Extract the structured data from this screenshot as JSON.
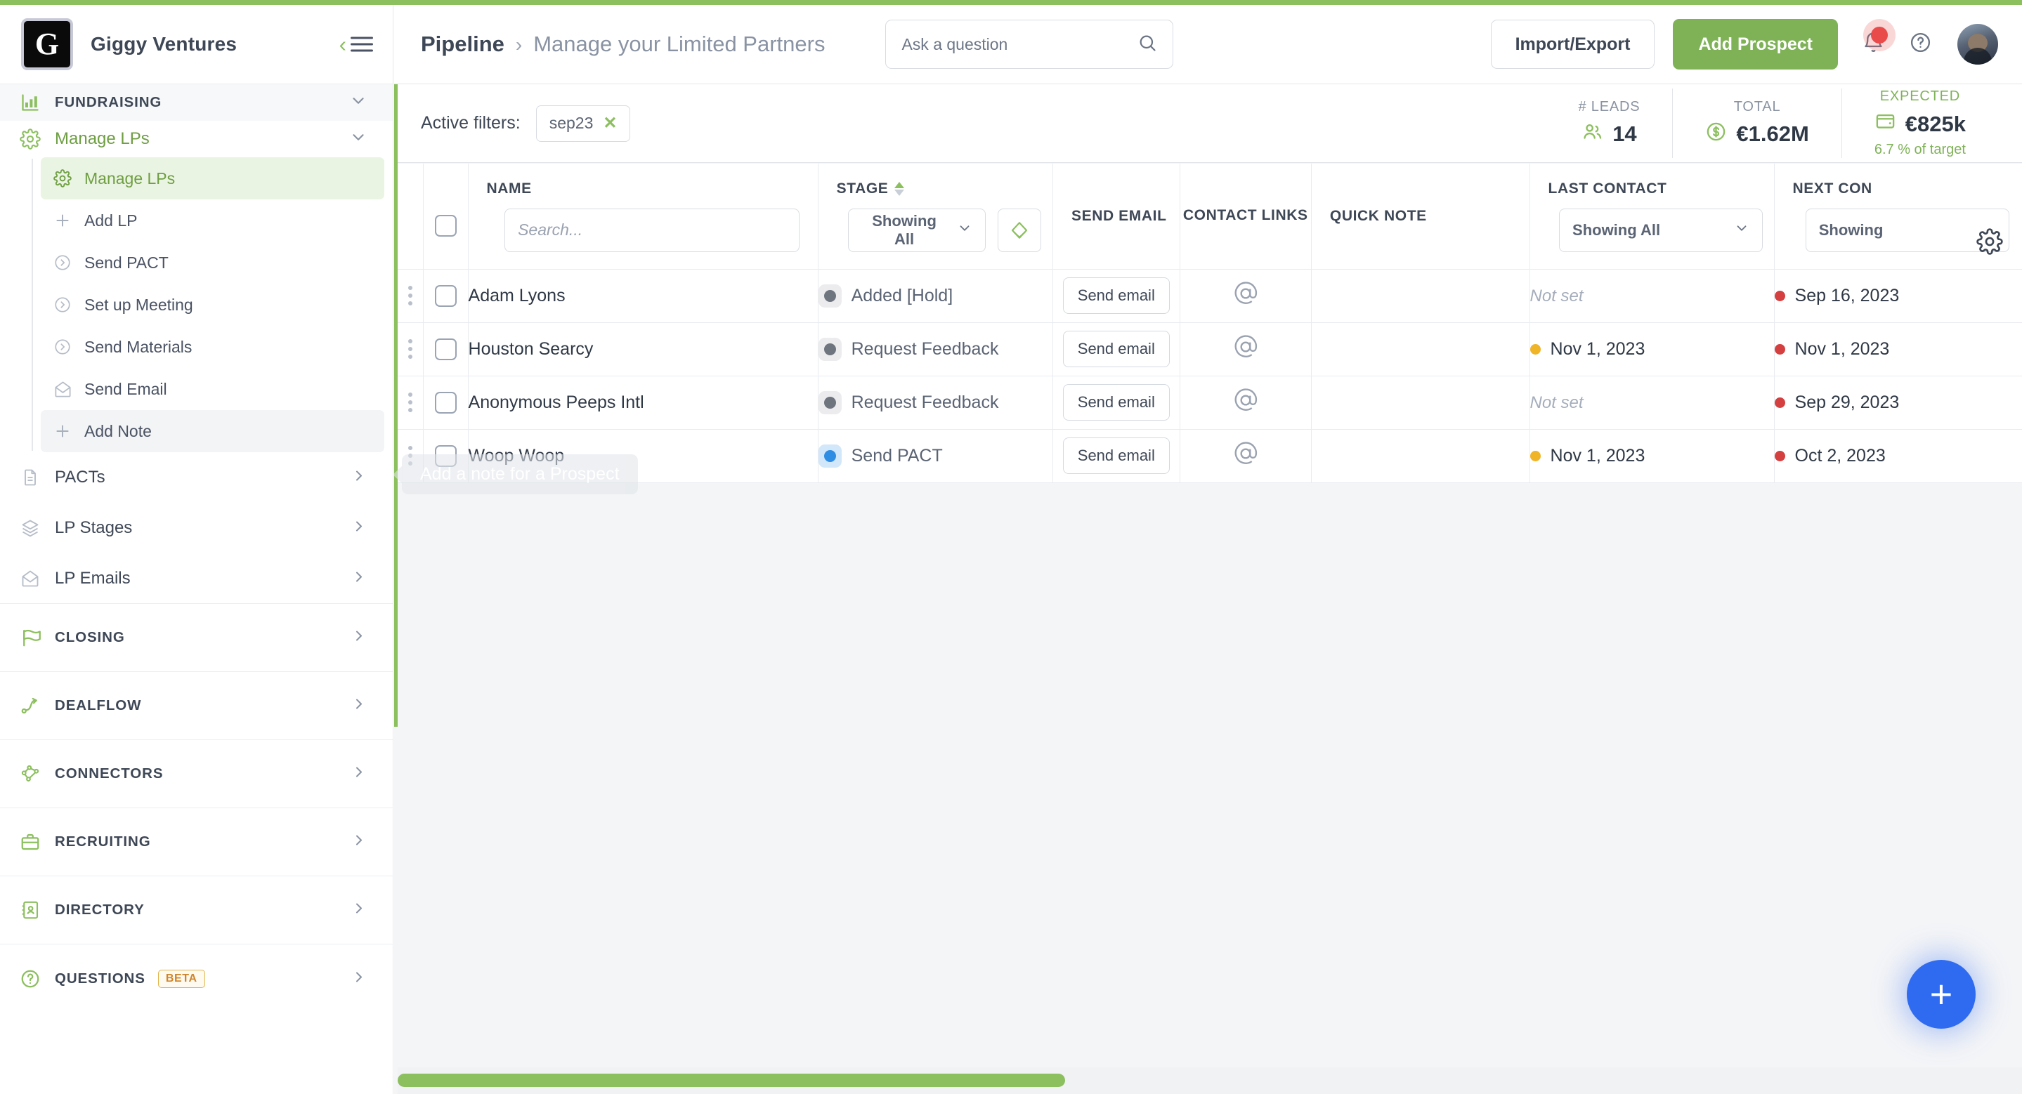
{
  "brand": {
    "logo_letter": "G",
    "name": "Giggy Ventures",
    "collapse_icon": "chevron-left-icon",
    "menu_icon": "hamburger-icon"
  },
  "sidebar": {
    "sections": [
      {
        "label": "FUNDRAISING",
        "icon": "bar-chart-icon",
        "caret": "chevron-down-icon",
        "state": "expanded"
      },
      {
        "label": "Manage LPs",
        "icon": "gear-icon",
        "caret": "chevron-down-icon",
        "state": "expanded"
      }
    ],
    "manage_lps_children": [
      {
        "label": "Manage LPs",
        "icon": "gear-icon",
        "state": "active"
      },
      {
        "label": "Add LP",
        "icon": "plus-icon",
        "state": "default"
      },
      {
        "label": "Send PACT",
        "icon": "circle-arrow-icon",
        "state": "default"
      },
      {
        "label": "Set up Meeting",
        "icon": "circle-arrow-icon",
        "state": "default"
      },
      {
        "label": "Send Materials",
        "icon": "circle-arrow-icon",
        "state": "default"
      },
      {
        "label": "Send Email",
        "icon": "envelope-icon",
        "state": "default"
      },
      {
        "label": "Add Note",
        "icon": "plus-icon",
        "state": "hover"
      }
    ],
    "fundraising_items": [
      {
        "label": "PACTs",
        "icon": "document-icon",
        "caret": "chevron-right-icon"
      },
      {
        "label": "LP Stages",
        "icon": "layers-icon",
        "caret": "chevron-right-icon"
      },
      {
        "label": "LP Emails",
        "icon": "envelope-icon",
        "caret": "chevron-right-icon"
      }
    ],
    "bottom_sections": [
      {
        "label": "CLOSING",
        "icon": "flag-icon",
        "caret": "chevron-right-icon",
        "badge": ""
      },
      {
        "label": "DEALFLOW",
        "icon": "flow-arrow-icon",
        "caret": "chevron-right-icon",
        "badge": ""
      },
      {
        "label": "CONNECTORS",
        "icon": "network-icon",
        "caret": "chevron-right-icon",
        "badge": ""
      },
      {
        "label": "RECRUITING",
        "icon": "briefcase-icon",
        "caret": "chevron-right-icon",
        "badge": ""
      },
      {
        "label": "DIRECTORY",
        "icon": "address-book-icon",
        "caret": "chevron-right-icon",
        "badge": ""
      },
      {
        "label": "QUESTIONS",
        "icon": "question-circle-icon",
        "caret": "chevron-right-icon",
        "badge": "BETA"
      }
    ]
  },
  "header": {
    "breadcrumb_root": "Pipeline",
    "breadcrumb_sep": "›",
    "breadcrumb_leaf": "Manage your Limited Partners",
    "search_placeholder": "Ask a question",
    "search_value": "",
    "search_icon": "search-icon",
    "import_export_label": "Import/Export",
    "add_prospect_label": "Add Prospect",
    "bell_icon": "bell-icon",
    "help_icon": "help-circle-icon",
    "avatar_icon": "avatar"
  },
  "filters": {
    "label": "Active filters:",
    "chips": [
      {
        "text": "sep23",
        "remove": "✕"
      }
    ]
  },
  "stats": [
    {
      "label": "# LEADS",
      "icon": "people-icon",
      "value": "14",
      "sub": "",
      "accent": "#5b6474"
    },
    {
      "label": "TOTAL",
      "icon": "dollar-circle-icon",
      "value": "€1.62M",
      "sub": "",
      "accent": "#5b6474"
    },
    {
      "label": "EXPECTED",
      "icon": "wallet-icon",
      "value": "€825k",
      "sub": "6.7 % of target",
      "accent": "#7fb257"
    }
  ],
  "table": {
    "columns": [
      {
        "key": "drag",
        "label": ""
      },
      {
        "key": "check",
        "label": ""
      },
      {
        "key": "name",
        "label": "NAME"
      },
      {
        "key": "stage",
        "label": "STAGE",
        "sorted": "asc"
      },
      {
        "key": "send_email",
        "label": "SEND EMAIL"
      },
      {
        "key": "contact_links",
        "label": "CONTACT LINKS"
      },
      {
        "key": "quick_note",
        "label": "QUICK NOTE"
      },
      {
        "key": "last_contact",
        "label": "LAST CONTACT"
      },
      {
        "key": "next_contact",
        "label": "NEXT CON"
      }
    ],
    "controls": {
      "name_search_placeholder": "Search...",
      "name_search_value": "",
      "stage_select": "Showing All",
      "stage_layers_icon": "layers-icon",
      "last_contact_select": "Showing All",
      "next_contact_select": "Showing",
      "settings_icon": "gear-icon",
      "select_caret": "chevron-down-icon"
    },
    "rows": [
      {
        "name": "Adam Lyons",
        "stage": "Added [Hold]",
        "stage_color": "gray",
        "send_email": "Send email",
        "contact_link_icon": "at-icon",
        "quick_note": "",
        "last_contact": "Not set",
        "last_contact_state": "unset",
        "last_contact_dot": "",
        "next_contact": "Sep 16, 2023",
        "next_contact_dot": "red"
      },
      {
        "name": "Houston Searcy",
        "stage": "Request Feedback",
        "stage_color": "gray",
        "send_email": "Send email",
        "contact_link_icon": "at-icon",
        "quick_note": "",
        "last_contact": "Nov 1, 2023",
        "last_contact_state": "set",
        "last_contact_dot": "amber",
        "next_contact": "Nov 1, 2023",
        "next_contact_dot": "red"
      },
      {
        "name": "Anonymous Peeps Intl",
        "stage": "Request Feedback",
        "stage_color": "gray",
        "send_email": "Send email",
        "contact_link_icon": "at-icon",
        "quick_note": "",
        "last_contact": "Not set",
        "last_contact_state": "unset",
        "last_contact_dot": "",
        "next_contact": "Sep 29, 2023",
        "next_contact_dot": "red"
      },
      {
        "name": "Woop Woop",
        "stage": "Send PACT",
        "stage_color": "blue",
        "send_email": "Send email",
        "contact_link_icon": "at-icon",
        "quick_note": "",
        "last_contact": "Nov 1, 2023",
        "last_contact_state": "set",
        "last_contact_dot": "amber",
        "next_contact": "Oct 2, 2023",
        "next_contact_dot": "red"
      }
    ]
  },
  "tooltip": {
    "text": "Add a note for a Prospect"
  },
  "fab": {
    "icon": "plus-icon",
    "label": "+"
  },
  "colors": {
    "brand_green": "#8cbf5e",
    "primary_button": "#7fb257",
    "fab_blue": "#2f6bf0",
    "badge_red": "#e94b4b",
    "date_amber": "#f0b429",
    "date_red": "#d43f3f",
    "stage_blue": "#2f8de4"
  }
}
